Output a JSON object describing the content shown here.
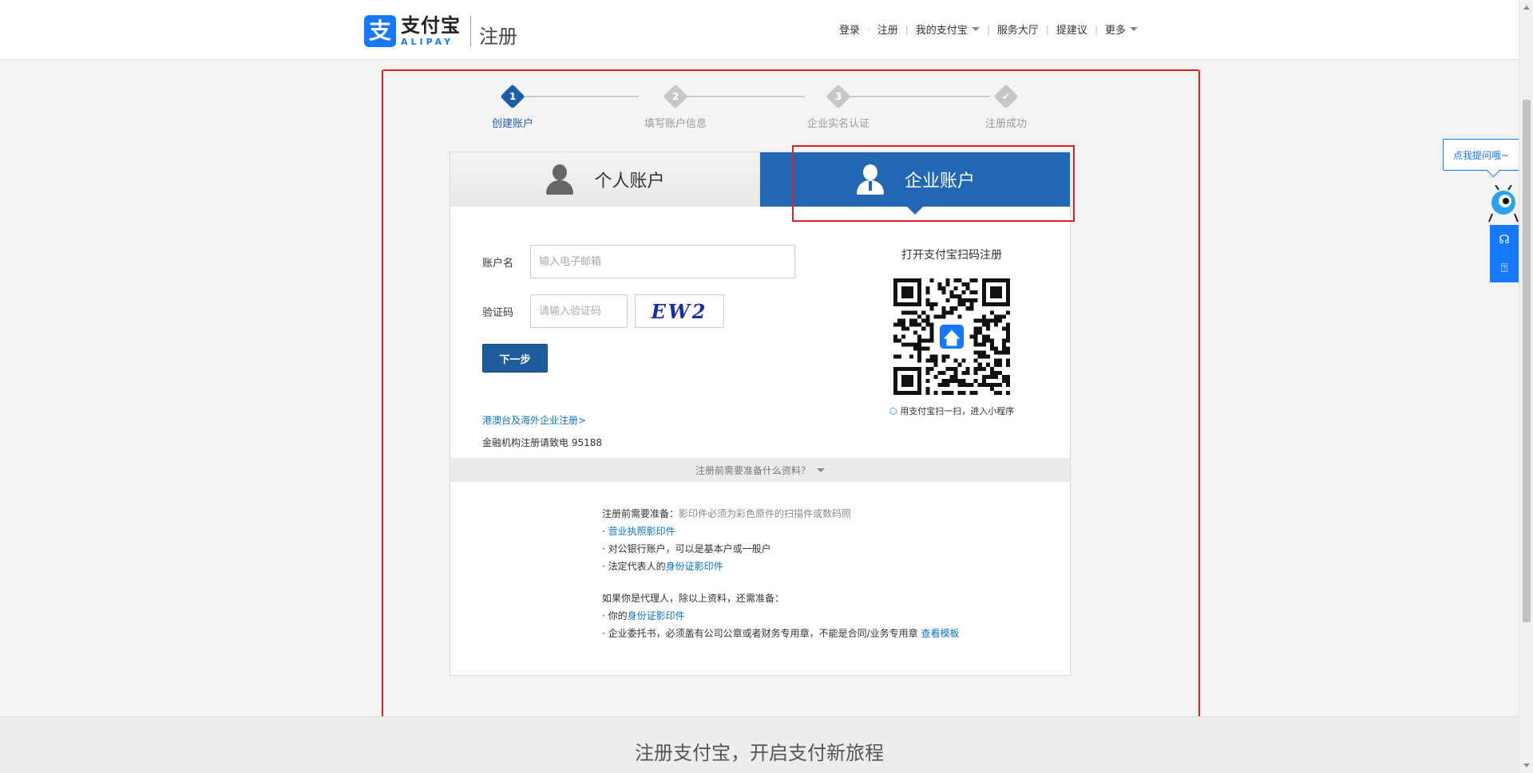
{
  "header": {
    "logo_mark": "支",
    "logo_cn": "支付宝",
    "logo_en": "ALIPAY",
    "logo_sub": "注册",
    "nav": {
      "login": "登录",
      "dot": "·",
      "register": "注册",
      "sep": "|",
      "my_alipay": "我的支付宝",
      "service": "服务大厅",
      "feedback": "提建议",
      "more": "更多"
    }
  },
  "steps": [
    {
      "num": "1",
      "label": "创建账户"
    },
    {
      "num": "2",
      "label": "填写账户信息"
    },
    {
      "num": "3",
      "label": "企业实名认证"
    },
    {
      "num": "✔",
      "label": "注册成功"
    }
  ],
  "tabs": {
    "personal": "个人账户",
    "business": "企业账户"
  },
  "form": {
    "account_label": "账户名",
    "account_placeholder": "输入电子邮箱",
    "captcha_label": "验证码",
    "captcha_placeholder": "请输入验证码",
    "captcha_image_text": "EW2",
    "next_button": "下一步",
    "overseas_link": "港澳台及海外企业注册>",
    "finance_tip": "金融机构注册请致电 95188"
  },
  "qr": {
    "title": "打开支付宝扫码注册",
    "caption": "用支付宝扫一扫，进入小程序"
  },
  "prep": {
    "bar": "注册前需要准备什么资料？",
    "intro_label": "注册前需要准备：",
    "intro_note": "影印件必须为彩色原件的扫描件或数码照",
    "items_part1": [
      {
        "prefix": "· ",
        "blue": "营业执照影印件",
        "suffix": ""
      },
      {
        "prefix": "· 对公银行账户，可以是基本户或一般户",
        "blue": "",
        "suffix": ""
      },
      {
        "prefix": "· 法定代表人的",
        "blue": "身份证影印件",
        "suffix": ""
      }
    ],
    "agent_intro": "如果你是代理人，除以上资料，还需准备：",
    "items_part2": [
      {
        "prefix": "· 你的",
        "blue": "身份证影印件",
        "suffix": ""
      },
      {
        "prefix": "· 企业委托书，必须盖有公司公章或者财务专用章，不能是合同/业务专用章 ",
        "blue": "查看模板",
        "suffix": ""
      }
    ]
  },
  "footer": {
    "slogan": "注册支付宝，开启支付新旅程"
  },
  "help": {
    "bubble": "点我提问哦~"
  },
  "colors": {
    "brand_blue": "#1677ff",
    "active_step": "#1a5fa8",
    "business_tab": "#2267b4",
    "highlight_red": "#e02020",
    "link_blue": "#0a74c7"
  }
}
